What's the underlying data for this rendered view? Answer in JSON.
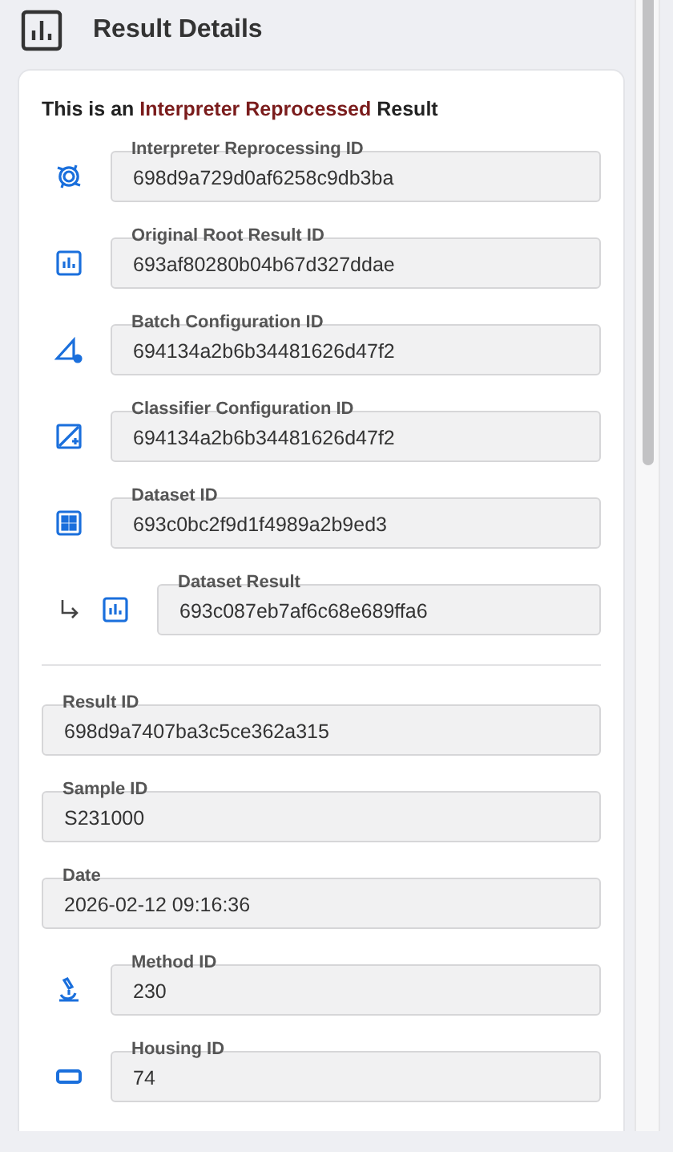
{
  "header": {
    "title": "Result Details"
  },
  "card": {
    "headline": "This is an **Interpreter Reprocessed** Result",
    "fields": [
      {
        "kind": "icon",
        "label": "Interpreter Reprocessing ID",
        "value": "698d9a729d0af6258c9db3ba"
      },
      {
        "kind": "icon",
        "label": "Original Root Result ID",
        "value": "693af80280b04b67d327ddae"
      },
      {
        "kind": "icon",
        "label": "Batch Configuration ID",
        "value": "694134a2b6b34481626d47f2"
      },
      {
        "kind": "icon",
        "label": "Classifier Configuration ID",
        "value": "694134a2b6b34481626d47f2"
      },
      {
        "kind": "icon",
        "label": "Dataset ID",
        "value": "693c0bc2f9d1f4989a2b9ed3"
      },
      {
        "kind": "nested",
        "label": "Dataset Result",
        "value": "693c087eb7af6c68e689ffa6"
      },
      {
        "kind": "divider"
      },
      {
        "kind": "plain",
        "label": "Result ID",
        "value": "698d9a7407ba3c5ce362a315"
      },
      {
        "kind": "plain",
        "label": "Sample ID",
        "value": "S231000"
      },
      {
        "kind": "plain",
        "label": "Date",
        "value": "2026-02-12 09:16:36"
      },
      {
        "kind": "icon",
        "label": "Method ID",
        "value": "230"
      },
      {
        "kind": "icon",
        "label": "Housing ID",
        "value": "74"
      }
    ]
  }
}
